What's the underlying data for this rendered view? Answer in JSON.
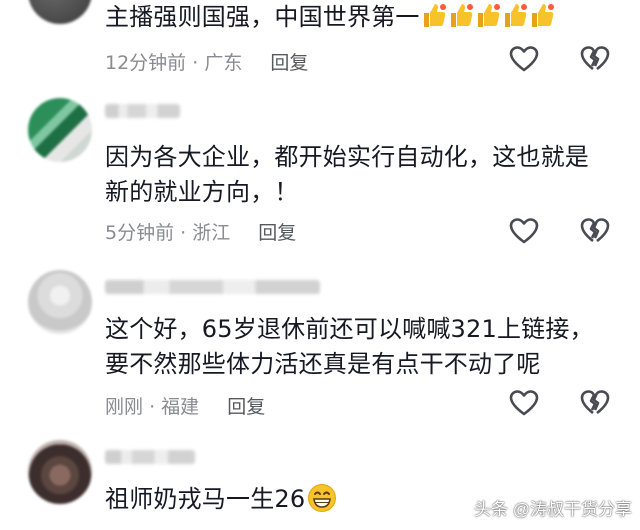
{
  "comments": [
    {
      "text": "主播强则国强，中国世界第一",
      "time": "12分钟前",
      "location": "广东",
      "reply": "回复",
      "emoji": "thumbs-up",
      "emoji_count": 5
    },
    {
      "text": "因为各大企业，都开始实行自动化，这也就是新的就业方向，！",
      "time": "5分钟前",
      "location": "浙江",
      "reply": "回复"
    },
    {
      "text": "这个好，65岁退休前还可以喊喊321上链接，要不然那些体力活还真是有点干不动了呢",
      "time": "刚刚",
      "location": "福建",
      "reply": "回复"
    },
    {
      "text": "祖师奶戎马一生26",
      "emoji": "grinning-face"
    }
  ],
  "separator": "·",
  "watermark": "头条 @涛叔干货分享",
  "colors": {
    "text": "#161823",
    "meta": "#8a8b91",
    "icon": "#4a4b52",
    "emoji": "#f7c22a"
  }
}
